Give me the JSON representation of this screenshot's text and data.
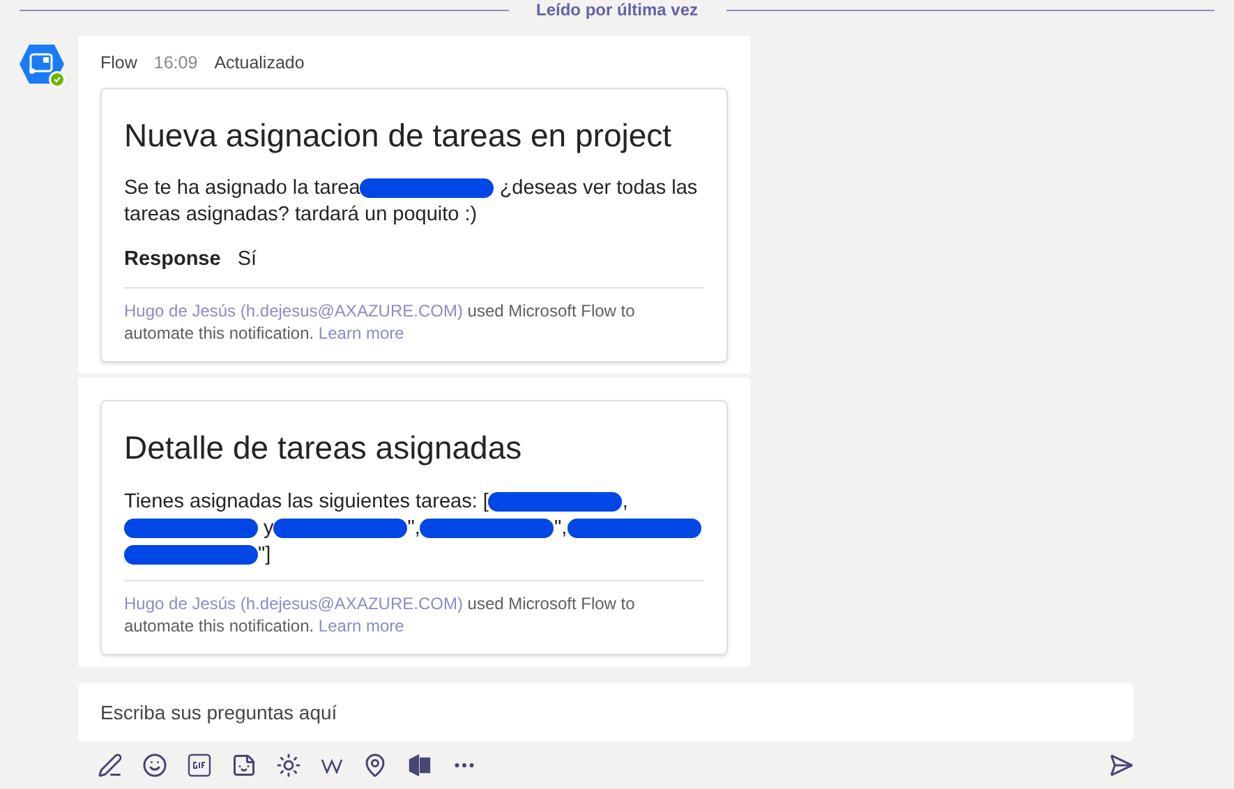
{
  "divider": {
    "label": "Leído por última vez"
  },
  "message": {
    "sender": "Flow",
    "time": "16:09",
    "status": "Actualizado",
    "cards": [
      {
        "title": "Nueva asignacion de tareas en project",
        "body": [
          {
            "kind": "text",
            "text": "Se te ha asignado la tarea"
          },
          {
            "kind": "redaction"
          },
          {
            "kind": "text",
            "text": " ¿deseas ver todas las tareas asignadas? tardará un poquito :)"
          }
        ],
        "facts": [
          {
            "label": "Response",
            "value": "Sí"
          }
        ],
        "footer": {
          "author": "Hugo de Jesús (h.dejesus@AXAZURE.COM)",
          "text": " used Microsoft Flow to automate this notification. ",
          "link": "Learn more"
        }
      },
      {
        "title": "Detalle de tareas asignadas",
        "body": [
          {
            "kind": "text",
            "text": "Tienes asignadas las siguientes tareas: ["
          },
          {
            "kind": "redaction"
          },
          {
            "kind": "text",
            "text": ","
          },
          {
            "kind": "redaction"
          },
          {
            "kind": "text",
            "text": " y"
          },
          {
            "kind": "redaction"
          },
          {
            "kind": "text",
            "text": "\","
          },
          {
            "kind": "redaction"
          },
          {
            "kind": "text",
            "text": "\","
          },
          {
            "kind": "redaction"
          },
          {
            "kind": "redaction"
          },
          {
            "kind": "text",
            "text": "\"]"
          }
        ],
        "footer": {
          "author": "Hugo de Jesús (h.dejesus@AXAZURE.COM)",
          "text": " used Microsoft Flow to automate this notification. ",
          "link": "Learn more"
        }
      }
    ]
  },
  "compose": {
    "placeholder": "Escriba sus preguntas aquí"
  }
}
